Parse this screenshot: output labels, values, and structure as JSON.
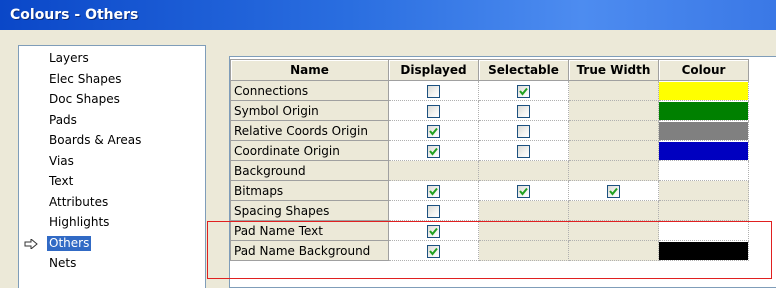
{
  "window": {
    "title": "Colours - Others"
  },
  "tree": {
    "items": [
      {
        "label": "Layers"
      },
      {
        "label": "Elec Shapes"
      },
      {
        "label": "Doc Shapes"
      },
      {
        "label": "Pads"
      },
      {
        "label": "Boards & Areas"
      },
      {
        "label": "Vias"
      },
      {
        "label": "Text"
      },
      {
        "label": "Attributes"
      },
      {
        "label": "Highlights"
      },
      {
        "label": "Others",
        "selected": true
      },
      {
        "label": "Nets"
      }
    ]
  },
  "grid": {
    "headers": [
      "Name",
      "Displayed",
      "Selectable",
      "True Width",
      "Colour"
    ],
    "rows": [
      {
        "name": "Connections",
        "displayed": false,
        "selectable": true,
        "true_width": null,
        "colour": "#ffff00"
      },
      {
        "name": "Symbol Origin",
        "displayed": false,
        "selectable": false,
        "true_width": null,
        "colour": "#008000"
      },
      {
        "name": "Relative Coords Origin",
        "displayed": true,
        "selectable": false,
        "true_width": null,
        "colour": "#808080"
      },
      {
        "name": "Coordinate Origin",
        "displayed": true,
        "selectable": false,
        "true_width": null,
        "colour": "#0000c0"
      },
      {
        "name": "Background",
        "displayed": null,
        "selectable": null,
        "true_width": null,
        "colour": "#ffffff"
      },
      {
        "name": "Bitmaps",
        "displayed": true,
        "selectable": true,
        "true_width": true,
        "colour": null
      },
      {
        "name": "Spacing Shapes",
        "displayed": false,
        "selectable": null,
        "true_width": null,
        "colour": null
      },
      {
        "name": "Pad Name Text",
        "displayed": true,
        "selectable": null,
        "true_width": null,
        "colour": "#ffffff"
      },
      {
        "name": "Pad Name Background",
        "displayed": true,
        "selectable": null,
        "true_width": null,
        "colour": "#000000"
      }
    ]
  },
  "colors": {
    "highlight_box": "#e02020",
    "selection": "#316ac5",
    "check": "#21a121"
  }
}
